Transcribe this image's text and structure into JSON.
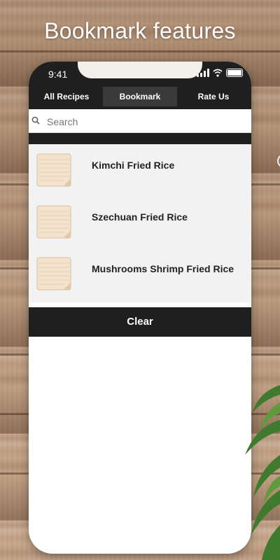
{
  "banner": {
    "title": "Bookmark features"
  },
  "status_bar": {
    "time": "9:41"
  },
  "tabs": [
    {
      "label": "All Recipes",
      "active": false
    },
    {
      "label": "Bookmark",
      "active": true
    },
    {
      "label": "Rate Us",
      "active": false
    }
  ],
  "search": {
    "placeholder": "Search",
    "value": ""
  },
  "bookmarks": [
    {
      "title": "Kimchi Fried Rice",
      "icon": "recipe-note-icon"
    },
    {
      "title": "Szechuan Fried Rice",
      "icon": "recipe-note-icon"
    },
    {
      "title": "Mushrooms Shrimp Fried Rice",
      "icon": "recipe-note-icon"
    }
  ],
  "actions": {
    "clear_label": "Clear"
  },
  "colors": {
    "dark": "#1f1f1f",
    "active_tab": "#3a3a3a",
    "list_bg": "#f2f2f2",
    "paper": "#f3e3cc"
  }
}
